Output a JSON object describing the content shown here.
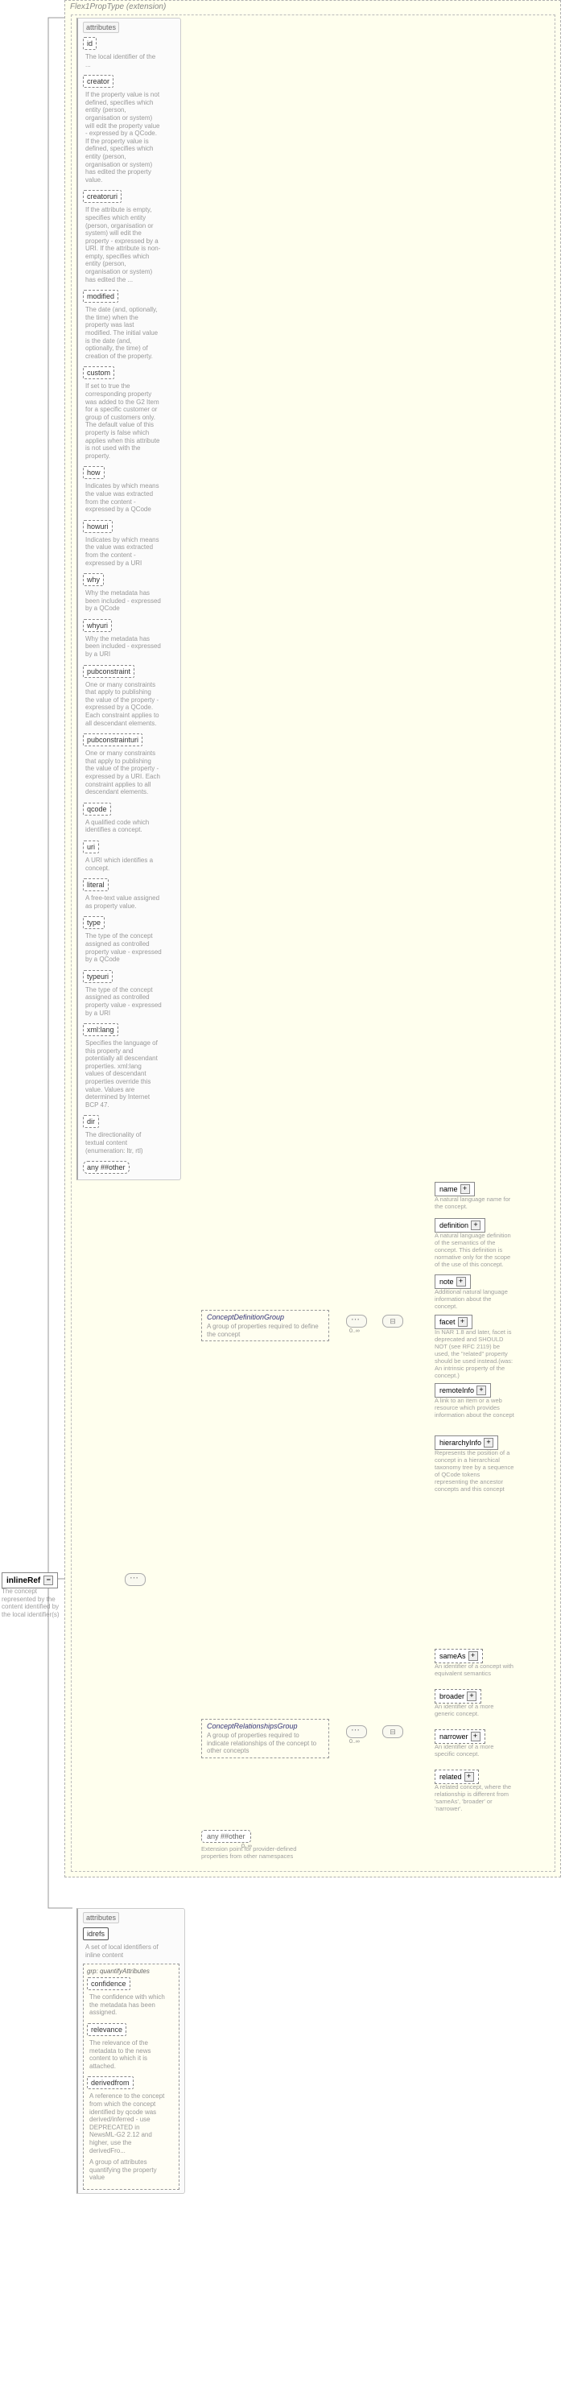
{
  "root": {
    "name": "inlineRef",
    "desc": "The concept represented by the content identified by the local identifier(s)"
  },
  "type": {
    "name": "Flex1PropType",
    "ext": "(extension)"
  },
  "attrs1": {
    "hdr": "attributes",
    "items": [
      {
        "n": "id",
        "d": "The local identifier of the property."
      },
      {
        "n": "creator",
        "d": "If the property value is not defined, specifies which entity (person, organisation or system) will edit the property - expressed by a QCode. If the property value is defined, specifies which entity (person, organisation or system) has edited the property value."
      },
      {
        "n": "creatoruri",
        "d": "If the attribute is empty, specifies which entity (person, organisation or system) will edit the property - expressed by a URI. If the attribute is non-empty, specifies which entity (person, organisation or system) has edited the property."
      },
      {
        "n": "modified",
        "d": "The date (and, optionally, the time) when the property was last modified. The initial value is the date (and, optionally, the time) of creation of the property."
      },
      {
        "n": "custom",
        "d": "If set to true the corresponding property was added to the G2 Item for a specific customer or group of customers only. The default value of this property is false which applies when this attribute is not used with the property."
      },
      {
        "n": "how",
        "d": "Indicates by which means the value was extracted from the content - expressed by a QCode"
      },
      {
        "n": "howuri",
        "d": "Indicates by which means the value was extracted from the content - expressed by a URI"
      },
      {
        "n": "why",
        "d": "Why the metadata has been included - expressed by a QCode"
      },
      {
        "n": "whyuri",
        "d": "Why the metadata has been included - expressed by a URI"
      },
      {
        "n": "pubconstraint",
        "d": "One or many constraints that apply to publishing the value of the property - expressed by a QCode. Each constraint applies to all descendant elements."
      },
      {
        "n": "pubconstrainturi",
        "d": "One or many constraints that apply to publishing the value of the property - expressed by a URI. Each constraint applies to all descendant elements."
      },
      {
        "n": "qcode",
        "d": "A qualified code which identifies a concept."
      },
      {
        "n": "uri",
        "d": "A URI which identifies a concept."
      },
      {
        "n": "literal",
        "d": "A free-text value assigned as property value."
      },
      {
        "n": "type",
        "d": "The type of the concept assigned as controlled property value - expressed by a QCode"
      },
      {
        "n": "typeuri",
        "d": "The type of the concept assigned as controlled property value - expressed by a URI"
      },
      {
        "n": "xml:lang",
        "d": "Specifies the language of this property and potentially all descendant properties. xml:lang values of descendant properties override this value. Values are determined by Internet BCP 47."
      },
      {
        "n": "dir",
        "d": "The directionality of textual content (enumeration: ltr, rtl)"
      }
    ],
    "any": "any ##other"
  },
  "seq": "·····",
  "groups": {
    "cdg": {
      "name": "ConceptDefinitionGroup",
      "desc": "A group of properties required to define the concept"
    },
    "crg": {
      "name": "ConceptRelationshipsGroup",
      "desc": "A group of properties required to indicate relationships of the concept to other concepts"
    }
  },
  "cdg_elems": [
    {
      "n": "name",
      "d": "A natural language name for the concept."
    },
    {
      "n": "definition",
      "d": "A natural language definition of the semantics of the concept. This definition is normative only for the scope of the use of this concept."
    },
    {
      "n": "note",
      "d": "Additional natural language information about the concept."
    },
    {
      "n": "facet",
      "d": "In NAR 1.8 and later: facet is deprecated and SHOULD NOT (see RFC 2119) be used, the \"related\" property should be used instead. (was: An intrinsic property of the concept.)"
    },
    {
      "n": "remoteInfo",
      "d": "A link to an item or a web resource which provides information about the concept"
    },
    {
      "n": "hierarchyInfo",
      "d": "Represents the position of a concept in a hierarchical taxonomy tree by a sequence of QCode tokens representing the ancestor concepts and this concept"
    }
  ],
  "crg_elems": [
    {
      "n": "sameAs",
      "d": "An identifier of a concept with equivalent semantics"
    },
    {
      "n": "broader",
      "d": "An identifier of a more generic concept."
    },
    {
      "n": "narrower",
      "d": "An identifier of a more specific concept."
    },
    {
      "n": "related",
      "d": "A related concept, where the relationship is different from 'sameAs', 'broader' or 'narrower'."
    }
  ],
  "ext_any": {
    "label": "any ##other",
    "desc": "Extension point for provider-defined properties from other namespaces"
  },
  "card": {
    "zi": "0..∞"
  },
  "attrs2": {
    "hdr": "attributes",
    "idrefs": {
      "n": "idrefs",
      "d": "A set of local identifiers of inline content"
    },
    "grp": {
      "name": "iptc-nar:quantifyAttributes",
      "items": [
        {
          "n": "confidence",
          "d": "The confidence with which the metadata has been assigned."
        },
        {
          "n": "relevance",
          "d": "The relevance of the metadata to the news content to which it is attached."
        },
        {
          "n": "derivedfrom",
          "d": "A reference to the concept from which the concept identified by qcode was derived/inferred - use of this attribute is DEPRECATED, use the derivedFro..."
        }
      ],
      "desc": "A group of attributes quantifying the property value."
    }
  }
}
